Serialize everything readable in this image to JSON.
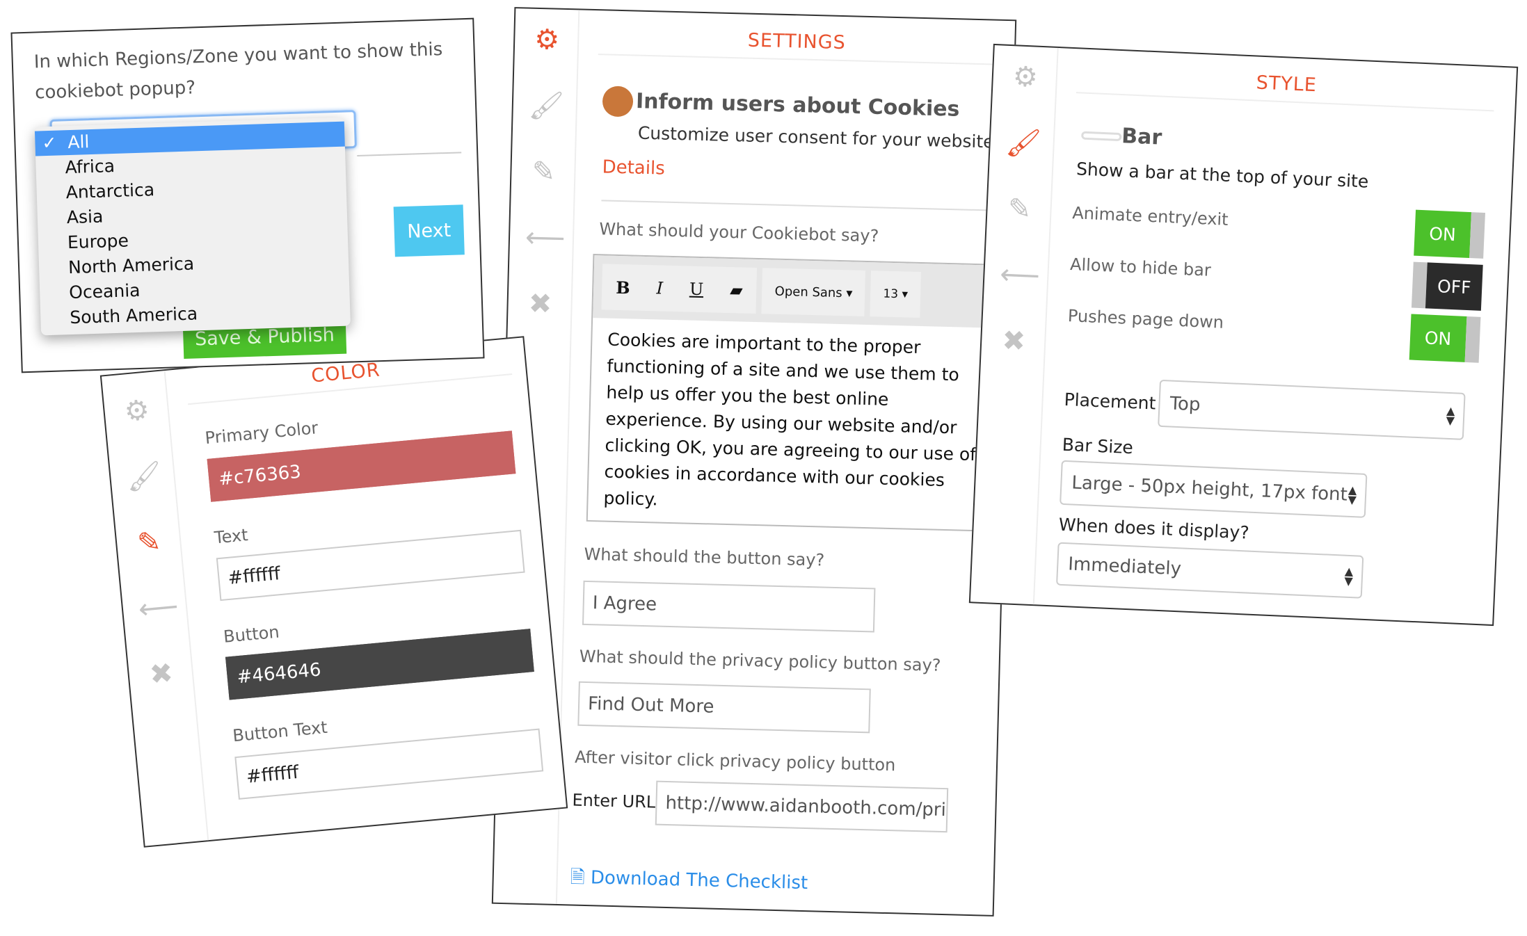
{
  "colors": {
    "accent": "#e8532f",
    "on": "#4cc12b",
    "off": "#2b2b2b",
    "next": "#4ec8f0",
    "save": "#4cc12b",
    "select_highlight": "#4a99f6"
  },
  "icons": [
    "gear-icon",
    "brush-icon",
    "pencil-icon",
    "arrow-left-icon",
    "close-icon"
  ],
  "regions": {
    "question": "In which Regions/Zone you want to show this cookiebot popup?",
    "options": [
      "All",
      "Africa",
      "Antarctica",
      "Asia",
      "Europe",
      "North America",
      "Oceania",
      "South America"
    ],
    "selected": "All",
    "check": "✓",
    "next": "Next",
    "save": "Save & Publish"
  },
  "settings": {
    "title": "SETTINGS",
    "heading": "Inform users about Cookies",
    "subtitle": "Customize user consent for your website",
    "details": "Details",
    "say_label": "What should your Cookiebot say?",
    "toolbar": {
      "bold": "B",
      "italic": "I",
      "underline": "U",
      "font": "Open Sans",
      "size": "13"
    },
    "body": "Cookies are important to the proper functioning of a site and we use them to help us offer you the best online experience. By using our website and/or clicking OK, you are agreeing to our use of cookies in accordance with our cookies policy.",
    "button_label": "What should the button say?",
    "button_value": "I Agree",
    "privacy_label": "What should the privacy policy button say?",
    "privacy_value": "Find Out More",
    "after_label": "After visitor click privacy policy button",
    "url_label": "Enter URL",
    "url_value": "http://www.aidanbooth.com/pri",
    "download": "Download The Checklist"
  },
  "style": {
    "title": "STYLE",
    "heading": "Bar",
    "subtitle": "Show a bar at the top of your site",
    "toggles": [
      {
        "label": "Animate entry/exit",
        "state": "ON"
      },
      {
        "label": "Allow to hide bar",
        "state": "OFF"
      },
      {
        "label": "Pushes page down",
        "state": "ON"
      }
    ],
    "placement_label": "Placement",
    "placement": "Top",
    "size_label": "Bar Size",
    "size": "Large - 50px height, 17px font",
    "display_label": "When does it display?",
    "display": "Immediately"
  },
  "color": {
    "title": "COLOR",
    "fields": [
      {
        "label": "Primary Color",
        "value": "#c76363"
      },
      {
        "label": "Text",
        "value": "#ffffff"
      },
      {
        "label": "Button",
        "value": "#464646"
      },
      {
        "label": "Button Text",
        "value": "#ffffff"
      }
    ]
  }
}
